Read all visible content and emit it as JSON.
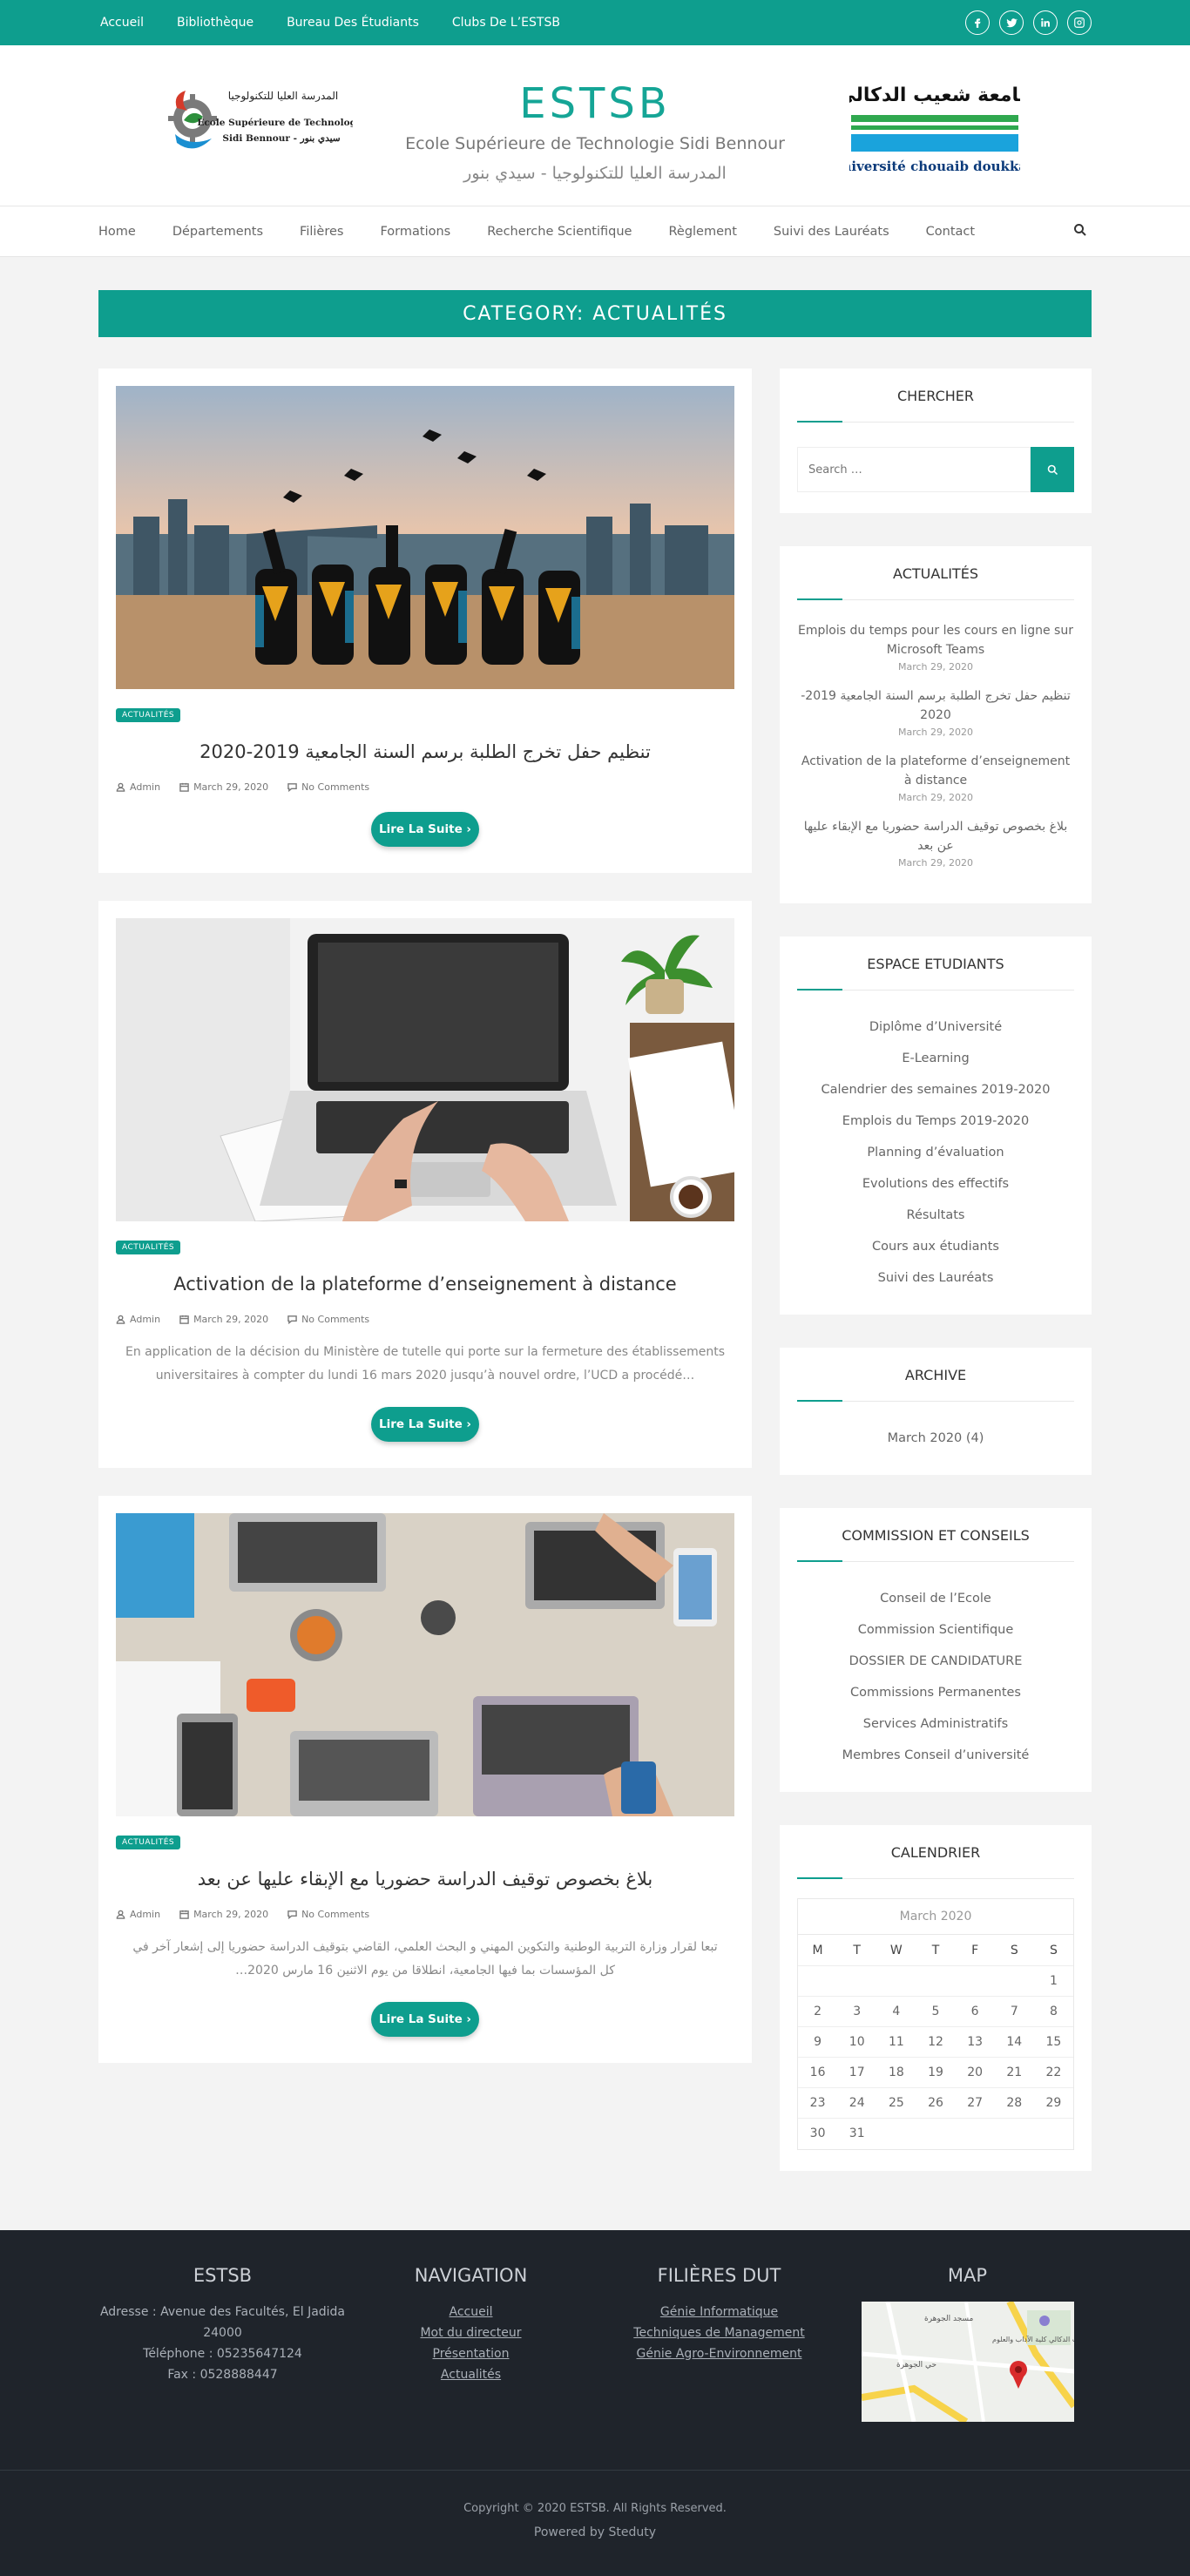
{
  "topbar": {
    "links": [
      "Accueil",
      "Bibliothèque",
      "Bureau Des Étudiants",
      "Clubs De L’ESTSB"
    ],
    "socials": [
      "facebook-icon",
      "twitter-icon",
      "linkedin-icon",
      "instagram-icon"
    ]
  },
  "header": {
    "title": "ESTSB",
    "subtitle_fr": "Ecole Supérieure de Technologie Sidi Bennour",
    "subtitle_ar": "المدرسة العليا للتكنولوجيا - سيدي بنور",
    "logo_left_ar": "المدرسة العليا للتكنولوجيا",
    "logo_left_line1": "Ecole Supérieure de Technologie",
    "logo_left_line2": "Sidi Bennour - سيدي بنور",
    "logo_right_ar": "جامعة شعيب الدكالي",
    "logo_right_fr": "université chouaib doukkali"
  },
  "nav": {
    "items": [
      "Home",
      "Départements",
      "Filières",
      "Formations",
      "Recherche Scientifique",
      "Règlement",
      "Suivi des Lauréats",
      "Contact"
    ]
  },
  "category": {
    "title": "CATEGORY: ACTUALITÉS"
  },
  "posts": [
    {
      "badge": "ACTUALITÉS",
      "title": "تنظيم حفل تخرج الطلبة برسم السنة الجامعية 2019-2020",
      "author": "Admin",
      "date": "March 29, 2020",
      "comments": "No Comments",
      "excerpt": "",
      "more": "Lire La Suite ›"
    },
    {
      "badge": "ACTUALITÉS",
      "title": "Activation de la plateforme d’enseignement à distance",
      "author": "Admin",
      "date": "March 29, 2020",
      "comments": "No Comments",
      "excerpt": "En application de la décision du Ministère de tutelle qui porte sur la fermeture des établissements universitaires à compter du lundi 16 mars 2020 jusqu’à nouvel ordre, l’UCD a procédé…",
      "more": "Lire La Suite ›"
    },
    {
      "badge": "ACTUALITÉS",
      "title": "بلاغ بخصوص توقيف الدراسة حضوريا مع الإبقاء عليها عن بعد",
      "author": "Admin",
      "date": "March 29, 2020",
      "comments": "No Comments",
      "excerpt": "تبعا لقرار وزارة التربية الوطنية والتكوين المهني و البحث العلمي، القاضي بتوقيف الدراسة حضوريا إلى إشعار آخر في كل المؤسسات بما فيها الجامعية، انطلاقا من يوم الاثنين 16 مارس 2020…",
      "more": "Lire La Suite ›"
    }
  ],
  "sidebar": {
    "search": {
      "title": "CHERCHER",
      "placeholder": "Search …"
    },
    "news": {
      "title": "ACTUALITÉS",
      "items": [
        {
          "title": "Emplois du temps pour les cours en ligne sur Microsoft Teams",
          "date": "March 29, 2020"
        },
        {
          "title": "تنظيم حفل تخرج الطلبة برسم السنة الجامعية 2019-2020",
          "date": "March 29, 2020"
        },
        {
          "title": "Activation de la plateforme d’enseignement à distance",
          "date": "March 29, 2020"
        },
        {
          "title": "بلاغ بخصوص توقيف الدراسة حضوريا مع الإبقاء عليها عن بعد",
          "date": "March 29, 2020"
        }
      ]
    },
    "students": {
      "title": "ESPACE ETUDIANTS",
      "items": [
        "Diplôme d’Université",
        "E-Learning",
        "Calendrier des semaines 2019-2020",
        "Emplois du Temps 2019-2020",
        "Planning d’évaluation",
        "Evolutions des effectifs",
        "Résultats",
        "Cours aux étudiants",
        "Suivi des Lauréats"
      ]
    },
    "archive": {
      "title": "ARCHIVE",
      "items": [
        "March 2020 (4)"
      ]
    },
    "commission": {
      "title": "COMMISSION ET CONSEILS",
      "items": [
        "Conseil de l’Ecole",
        "Commission Scientifique",
        "DOSSIER DE CANDIDATURE",
        "Commissions Permanentes",
        "Services Administratifs",
        "Membres Conseil d’université"
      ]
    },
    "calendar": {
      "title": "CALENDRIER",
      "caption": "March 2020",
      "days": [
        "M",
        "T",
        "W",
        "T",
        "F",
        "S",
        "S"
      ],
      "weeks": [
        [
          "",
          "",
          "",
          "",
          "",
          "",
          "1"
        ],
        [
          "2",
          "3",
          "4",
          "5",
          "6",
          "7",
          "8"
        ],
        [
          "9",
          "10",
          "11",
          "12",
          "13",
          "14",
          "15"
        ],
        [
          "16",
          "17",
          "18",
          "19",
          "20",
          "21",
          "22"
        ],
        [
          "23",
          "24",
          "25",
          "26",
          "27",
          "28",
          "29"
        ],
        [
          "30",
          "31",
          "",
          "",
          "",
          "",
          ""
        ]
      ]
    }
  },
  "footer": {
    "col1": {
      "title": "ESTSB",
      "lines": [
        "Adresse : Avenue des Facultés, El Jadida 24000",
        "Téléphone : 05235647124",
        "Fax : 0528888447"
      ]
    },
    "col2": {
      "title": "NAVIGATION",
      "links": [
        "Accueil",
        "Mot du directeur",
        "Présentation",
        "Actualités"
      ]
    },
    "col3": {
      "title": "FILIÈRES DUT",
      "links": [
        "Génie Informatique",
        "Techniques de Management",
        "Génie Agro-Environnement"
      ]
    },
    "col4": {
      "title": "MAP",
      "labels": [
        "مسجد الجوهرة",
        "جامعة شعيب الدكالي كلية الآداب والعلوم",
        "حي الجوهرة"
      ]
    },
    "copyright": "Copyright © 2020 ESTSB. All Rights Reserved.",
    "powered": "Powered by",
    "powered_brand": "Steduty"
  }
}
